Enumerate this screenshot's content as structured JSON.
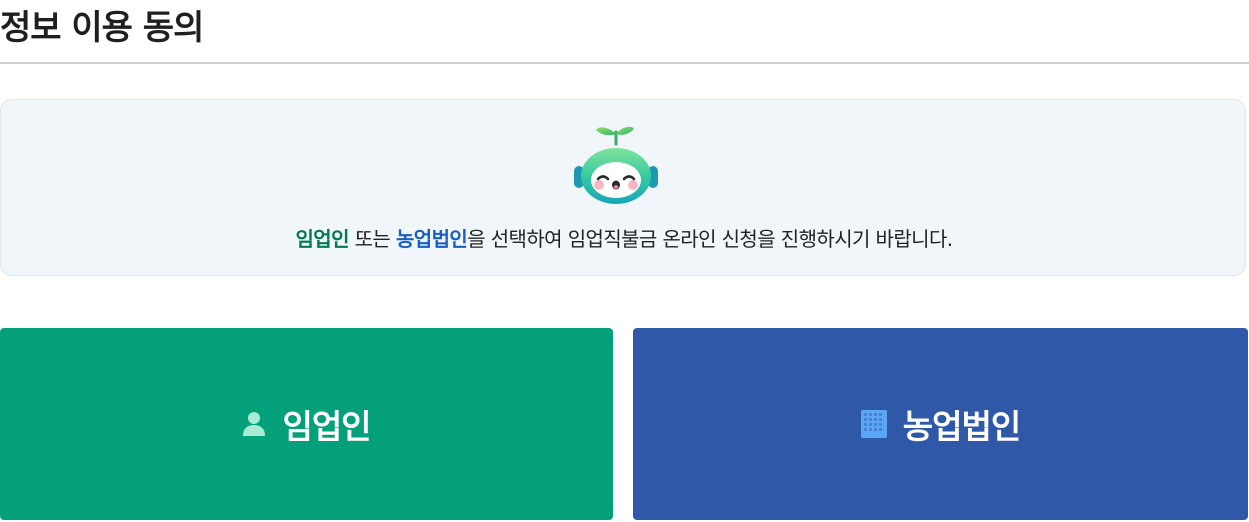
{
  "header": {
    "title": "정보 이용 동의"
  },
  "notice": {
    "mascot_icon": "sprout-robot-mascot-icon",
    "segments": [
      {
        "text": "임업인",
        "color": "#007a4d"
      },
      {
        "text": " 또는 ",
        "color": "#222222"
      },
      {
        "text": "농업법인",
        "color": "#1a5fbf"
      },
      {
        "text": "을 선택하여 임업직불금 온라인 신청을 진행하시기 바랍니다.",
        "color": "#222222"
      }
    ]
  },
  "choices": {
    "individual": {
      "label": "임업인",
      "icon": "person-icon",
      "bg_color": "#04a07a",
      "icon_color": "#a8ecd6"
    },
    "corporation": {
      "label": "농업법인",
      "icon": "building-icon",
      "bg_color": "#2f59a8",
      "icon_color": "#5aa6f5"
    }
  }
}
